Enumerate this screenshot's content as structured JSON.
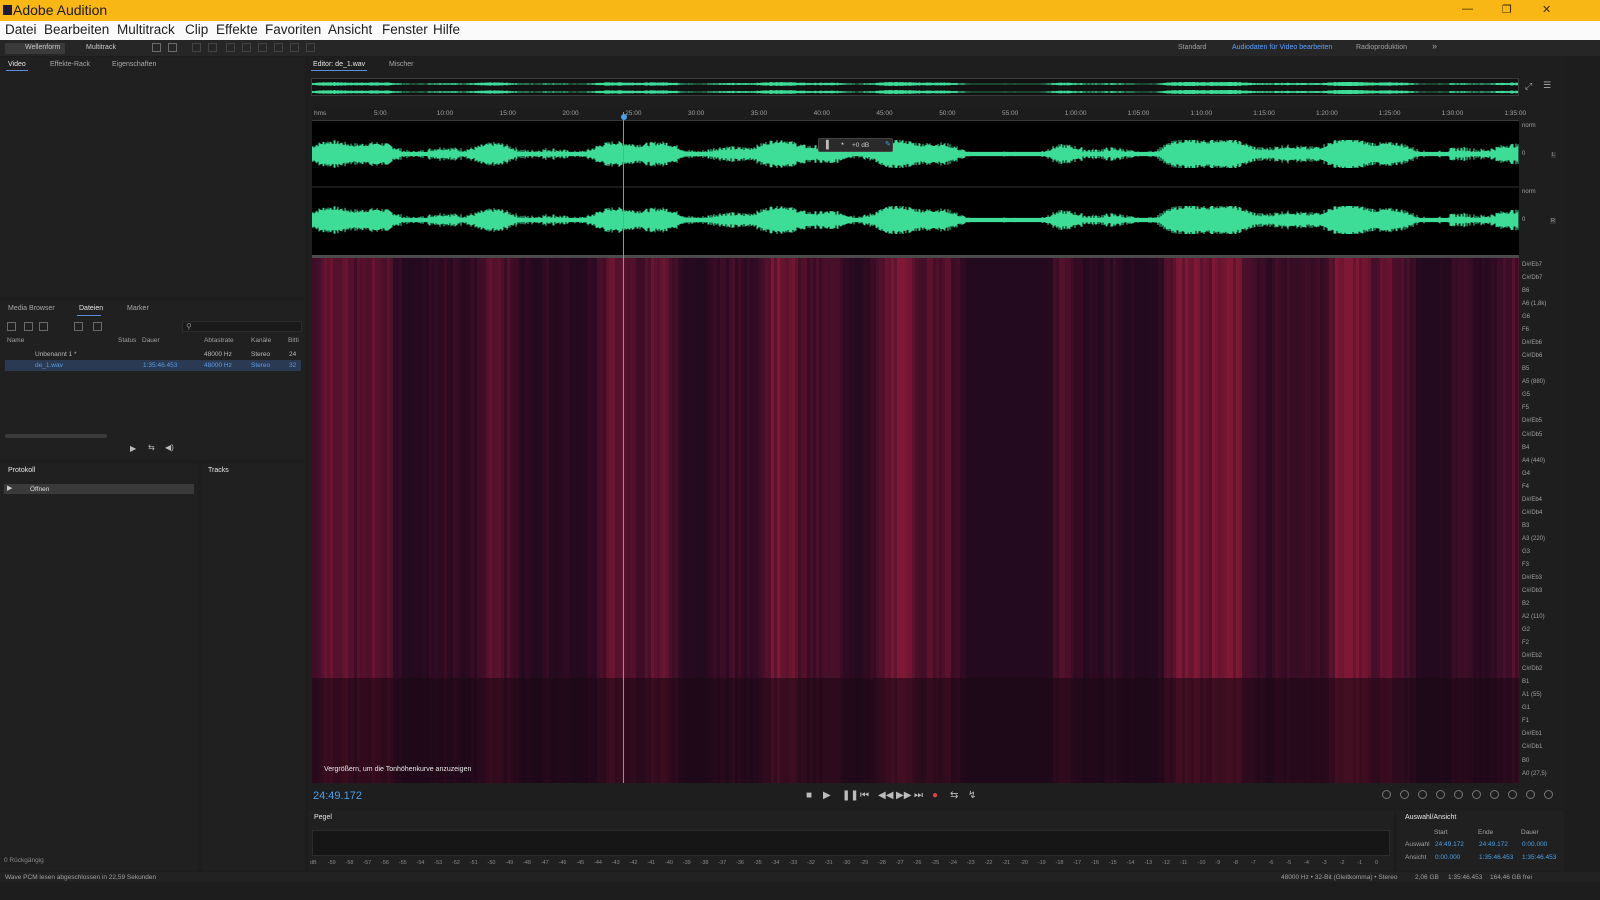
{
  "app": {
    "title": "Adobe Audition",
    "window_controls": [
      "—",
      "❐",
      "✕"
    ]
  },
  "menu": [
    "Datei",
    "Bearbeiten",
    "Multitrack",
    "Clip",
    "Effekte",
    "Favoriten",
    "Ansicht",
    "Fenster",
    "Hilfe"
  ],
  "toolbar": {
    "waveform": "Wellenform",
    "multitrack": "Multitrack",
    "workspaces": [
      "Standard",
      "Audiodaten für Video bearbeiten",
      "Radioproduktion"
    ],
    "more": "»"
  },
  "left_top_tabs": [
    "Video",
    "Effekte-Rack",
    "Eigenschaften"
  ],
  "files_panel": {
    "tabs": [
      "Media Browser",
      "Dateien",
      "Marker"
    ],
    "columns": [
      "Name",
      "Status",
      "Dauer",
      "Abtastrate",
      "Kanäle",
      "Bitti"
    ],
    "rows": [
      {
        "name": "Unbenannt 1 *",
        "status": "",
        "duration": "",
        "rate": "48000 Hz",
        "channels": "Stereo",
        "bits": "24"
      },
      {
        "name": "de_1.wav",
        "status": "",
        "duration": "1:35:46.453",
        "rate": "48000 Hz",
        "channels": "Stereo",
        "bits": "32"
      }
    ]
  },
  "history_panel": {
    "tab": "Protokoll",
    "item": "Öffnen",
    "footer": "0 Rückgängig"
  },
  "tracks_panel": {
    "tab": "Tracks"
  },
  "editor": {
    "tabs": [
      "Editor: de_1.wav",
      "Mischer"
    ],
    "hud_gain": "+0 dB",
    "tooltip": "Vergrößern, um die Tonhöhenkurve anzuzeigen",
    "timecode": "24:49.172",
    "ruler_labels": [
      "hms",
      "5:00",
      "10:00",
      "15:00",
      "20:00",
      "25:00",
      "30:00",
      "35:00",
      "40:00",
      "45:00",
      "50:00",
      "55:00",
      "1:00:00",
      "1:05:00",
      "1:10:00",
      "1:15:00",
      "1:20:00",
      "1:25:00",
      "1:30:00",
      "1:35:00"
    ],
    "amp_labels": [
      "norm",
      "0",
      "norm",
      "0"
    ],
    "channel_labels": [
      "L",
      "R"
    ],
    "pitch_labels": [
      "D#/Eb7",
      "C#/Db7",
      "B6",
      "A6 (1,8k)",
      "G6",
      "F6",
      "D#/Eb6",
      "C#/Db6",
      "B5",
      "A5 (880)",
      "G5",
      "F5",
      "D#/Eb5",
      "C#/Db5",
      "B4",
      "A4 (440)",
      "G4",
      "F4",
      "D#/Eb4",
      "C#/Db4",
      "B3",
      "A3 (220)",
      "G3",
      "F3",
      "D#/Eb3",
      "C#/Db3",
      "B2",
      "A2 (110)",
      "G2",
      "F2",
      "D#/Eb2",
      "C#/Db2",
      "B1",
      "A1 (55)",
      "G1",
      "F1",
      "D#/Eb1",
      "C#/Db1",
      "B0",
      "A0 (27,5)"
    ]
  },
  "transport": [
    "■",
    "▶",
    "❚❚",
    "⏮",
    "◀◀",
    "▶▶",
    "⏭",
    "●",
    "⇆",
    "↯"
  ],
  "pegel": {
    "tab": "Pegel",
    "scale": [
      "dB",
      "-59",
      "-58",
      "-57",
      "-56",
      "-55",
      "-54",
      "-53",
      "-52",
      "-51",
      "-50",
      "-49",
      "-48",
      "-47",
      "-46",
      "-45",
      "-44",
      "-43",
      "-42",
      "-41",
      "-40",
      "-39",
      "-38",
      "-37",
      "-36",
      "-35",
      "-34",
      "-33",
      "-32",
      "-31",
      "-30",
      "-29",
      "-28",
      "-27",
      "-26",
      "-25",
      "-24",
      "-23",
      "-22",
      "-21",
      "-20",
      "-19",
      "-18",
      "-17",
      "-16",
      "-15",
      "-14",
      "-13",
      "-12",
      "-11",
      "-10",
      "-9",
      "-8",
      "-7",
      "-6",
      "-5",
      "-4",
      "-3",
      "-2",
      "-1",
      "0"
    ]
  },
  "selection_view": {
    "tab": "Auswahl/Ansicht",
    "headers": [
      "Start",
      "Ende",
      "Dauer"
    ],
    "rows": [
      {
        "label": "Auswahl",
        "start": "24:49.172",
        "end": "24:49.172",
        "duration": "0:00.000"
      },
      {
        "label": "Ansicht",
        "start": "0:00.000",
        "end": "1:35:46.453",
        "duration": "1:35:46.453"
      }
    ]
  },
  "status": {
    "left": "Wave PCM lesen abgeschlossen in 22,59 Sekunden",
    "format": "48000 Hz • 32-Bit (Gleitkomma) • Stereo",
    "size": "2,06 GB",
    "duration": "1:35:46.453",
    "free": "164,46 GB frei"
  },
  "colors": {
    "titlebar": "#f9b716",
    "waveform": "#3ddc97",
    "accent": "#4aa0e8",
    "playhead": "#ff6a4a"
  }
}
